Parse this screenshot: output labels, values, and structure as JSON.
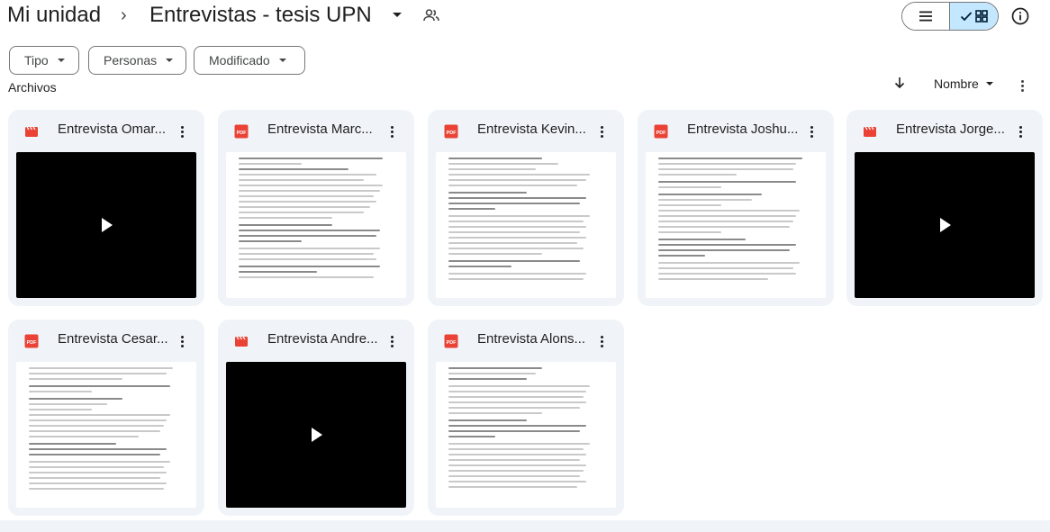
{
  "breadcrumb": {
    "root": "Mi unidad",
    "separator": "›",
    "current": "Entrevistas - tesis UPN",
    "shared_icon": "shared-folder-icon"
  },
  "toolbar": {
    "view_list_icon": "list-view-icon",
    "view_grid_icon": "grid-view-icon",
    "view_active": "grid",
    "info_icon": "info-icon"
  },
  "filters": [
    {
      "label": "Tipo"
    },
    {
      "label": "Personas"
    },
    {
      "label": "Modificado"
    }
  ],
  "section": {
    "label": "Archivos",
    "sort_label": "Nombre",
    "sort_direction_icon": "arrow-down-icon"
  },
  "colors": {
    "accent": "#c2e7ff",
    "card_bg": "#f0f4f9",
    "pdf_red": "#ea4335",
    "video_red": "#ea4335"
  },
  "files": [
    {
      "name": "Entrevista Omar...",
      "type": "video",
      "icon": "video-file-icon"
    },
    {
      "name": "Entrevista Marc...",
      "type": "pdf",
      "icon": "pdf-file-icon"
    },
    {
      "name": "Entrevista Kevin...",
      "type": "pdf",
      "icon": "pdf-file-icon"
    },
    {
      "name": "Entrevista Joshu...",
      "type": "pdf",
      "icon": "pdf-file-icon"
    },
    {
      "name": "Entrevista Jorge...",
      "type": "video",
      "icon": "video-file-icon"
    },
    {
      "name": "Entrevista Cesar...",
      "type": "pdf",
      "icon": "pdf-file-icon"
    },
    {
      "name": "Entrevista Andre...",
      "type": "video",
      "icon": "video-file-icon"
    },
    {
      "name": "Entrevista Alons...",
      "type": "pdf",
      "icon": "pdf-file-icon"
    }
  ]
}
